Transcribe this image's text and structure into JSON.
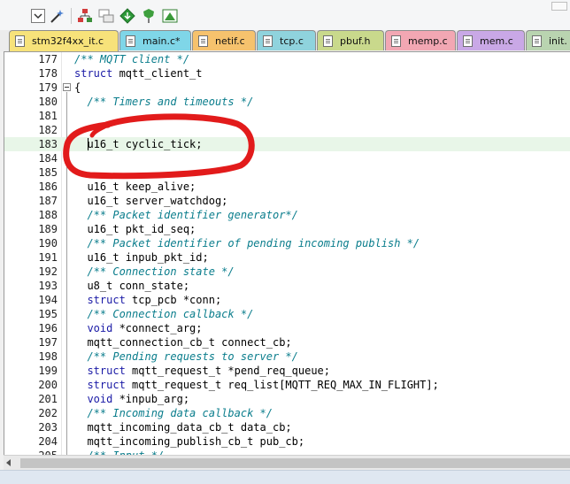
{
  "toolbar": {
    "icons": [
      "dropdown-arrow-icon",
      "magic-wand-icon",
      "diagram-icon",
      "windows-icon",
      "diamond-arrow-icon",
      "sketch-icon",
      "picture-icon"
    ]
  },
  "tabs": [
    {
      "label": "stm32f4xx_it.c",
      "color": "#f7e27a",
      "active": true
    },
    {
      "label": "main.c*",
      "color": "#7fd6e8"
    },
    {
      "label": "netif.c",
      "color": "#f6c26d"
    },
    {
      "label": "tcp.c",
      "color": "#8fd3dd"
    },
    {
      "label": "pbuf.h",
      "color": "#c9d98c"
    },
    {
      "label": "memp.c",
      "color": "#f2a7b3"
    },
    {
      "label": "mem.c",
      "color": "#c9a8e6"
    },
    {
      "label": "init.",
      "color": "#b9d4b0"
    }
  ],
  "editor": {
    "lines": [
      {
        "n": "177",
        "code": "/** MQTT client */",
        "type": "comment"
      },
      {
        "n": "178",
        "code": "struct mqtt_client_t",
        "type": "struct"
      },
      {
        "n": "179",
        "code": "{",
        "type": "plain"
      },
      {
        "n": "180",
        "code": "  /** Timers and timeouts */",
        "type": "comment"
      },
      {
        "n": "181",
        "code": "",
        "type": "plain"
      },
      {
        "n": "182",
        "code": "",
        "type": "plain"
      },
      {
        "n": "183",
        "code": "  u16_t cyclic_tick;",
        "type": "plain"
      },
      {
        "n": "184",
        "code": "",
        "type": "plain"
      },
      {
        "n": "185",
        "code": "",
        "type": "plain"
      },
      {
        "n": "186",
        "code": "  u16_t keep_alive;",
        "type": "plain"
      },
      {
        "n": "187",
        "code": "  u16_t server_watchdog;",
        "type": "plain"
      },
      {
        "n": "188",
        "code": "  /** Packet identifier generator*/",
        "type": "comment"
      },
      {
        "n": "189",
        "code": "  u16_t pkt_id_seq;",
        "type": "plain"
      },
      {
        "n": "190",
        "code": "  /** Packet identifier of pending incoming publish */",
        "type": "comment"
      },
      {
        "n": "191",
        "code": "  u16_t inpub_pkt_id;",
        "type": "plain"
      },
      {
        "n": "192",
        "code": "  /** Connection state */",
        "type": "comment"
      },
      {
        "n": "193",
        "code": "  u8_t conn_state;",
        "type": "plain"
      },
      {
        "n": "194",
        "code": "  struct tcp_pcb *conn;",
        "type": "struct"
      },
      {
        "n": "195",
        "code": "  /** Connection callback */",
        "type": "comment"
      },
      {
        "n": "196",
        "code": "  void *connect_arg;",
        "type": "void"
      },
      {
        "n": "197",
        "code": "  mqtt_connection_cb_t connect_cb;",
        "type": "plain"
      },
      {
        "n": "198",
        "code": "  /** Pending requests to server */",
        "type": "comment"
      },
      {
        "n": "199",
        "code": "  struct mqtt_request_t *pend_req_queue;",
        "type": "struct"
      },
      {
        "n": "200",
        "code": "  struct mqtt_request_t req_list[MQTT_REQ_MAX_IN_FLIGHT];",
        "type": "struct"
      },
      {
        "n": "201",
        "code": "  void *inpub_arg;",
        "type": "void"
      },
      {
        "n": "202",
        "code": "  /** Incoming data callback */",
        "type": "comment"
      },
      {
        "n": "203",
        "code": "  mqtt_incoming_data_cb_t data_cb;",
        "type": "plain"
      },
      {
        "n": "204",
        "code": "  mqtt_incoming_publish_cb_t pub_cb;",
        "type": "plain"
      },
      {
        "n": "205",
        "code": "  /** Input */",
        "type": "comment"
      }
    ],
    "current_line": "183"
  },
  "colors": {
    "keyword": "#1a1aa6",
    "comment": "#0a7d8c",
    "current_line_bg": "#e8f6e8",
    "annotation": "#e21b1b"
  }
}
